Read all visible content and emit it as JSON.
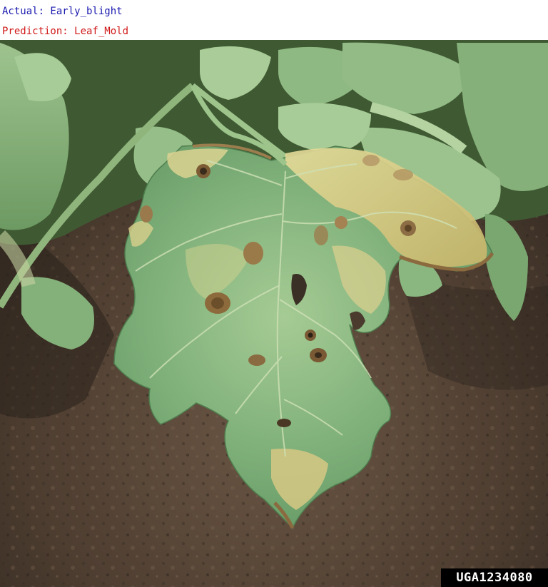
{
  "annotation": {
    "actual_text": "Actual: Early_blight",
    "actual_color": "#1a1ab0",
    "prediction_text": "Prediction: Leaf_Mold",
    "prediction_color": "#d01818"
  },
  "photo": {
    "subject": "tomato leaf with brown lesions and yellowing over soil",
    "watermark_id": "UGA1234080"
  }
}
